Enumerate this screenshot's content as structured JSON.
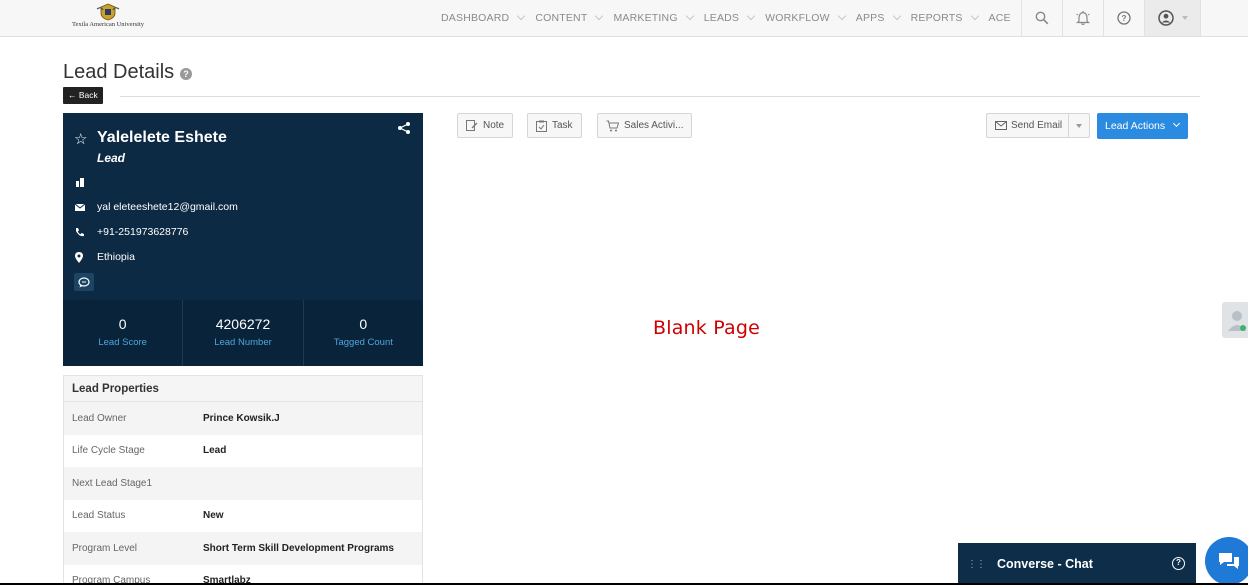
{
  "logo": {
    "text": "Texila American University"
  },
  "nav": {
    "items": [
      {
        "label": "DASHBOARD"
      },
      {
        "label": "CONTENT"
      },
      {
        "label": "MARKETING"
      },
      {
        "label": "LEADS"
      },
      {
        "label": "WORKFLOW"
      },
      {
        "label": "APPS"
      },
      {
        "label": "REPORTS"
      },
      {
        "label": "ACE"
      }
    ],
    "icons": [
      "search-icon",
      "bell-icon",
      "help-icon",
      "user-profile-icon"
    ]
  },
  "header": {
    "title": "Lead Details",
    "back_label": "Back",
    "help": "?"
  },
  "lead": {
    "name": "Yalelelete Eshete",
    "type": "Lead",
    "email": "yal eleteeshete12@gmail.com",
    "phone": "+91-251973628776",
    "country": "Ethiopia",
    "stats": [
      {
        "value": "0",
        "label": "Lead Score"
      },
      {
        "value": "4206272",
        "label": "Lead Number"
      },
      {
        "value": "0",
        "label": "Tagged Count"
      }
    ]
  },
  "properties": {
    "title": "Lead Properties",
    "rows": [
      {
        "key": "Lead Owner",
        "value": "Prince Kowsik.J"
      },
      {
        "key": "Life Cycle Stage",
        "value": "Lead"
      },
      {
        "key": "Next Lead Stage1",
        "value": ""
      },
      {
        "key": "Lead Status",
        "value": "New"
      },
      {
        "key": "Program Level",
        "value": "Short Term Skill Development Programs"
      },
      {
        "key": "Program Campus",
        "value": "Smartlabz"
      }
    ]
  },
  "actions": {
    "note": "Note",
    "task": "Task",
    "sales": "Sales Activi...",
    "send_email": "Send Email",
    "lead_actions": "Lead Actions"
  },
  "main": {
    "blank_text": "Blank Page"
  },
  "chat": {
    "title": "Converse - Chat",
    "help": "?"
  },
  "colors": {
    "card_bg": "#0c2a44",
    "accent": "#2b8be0",
    "blank_text": "#d00000"
  }
}
